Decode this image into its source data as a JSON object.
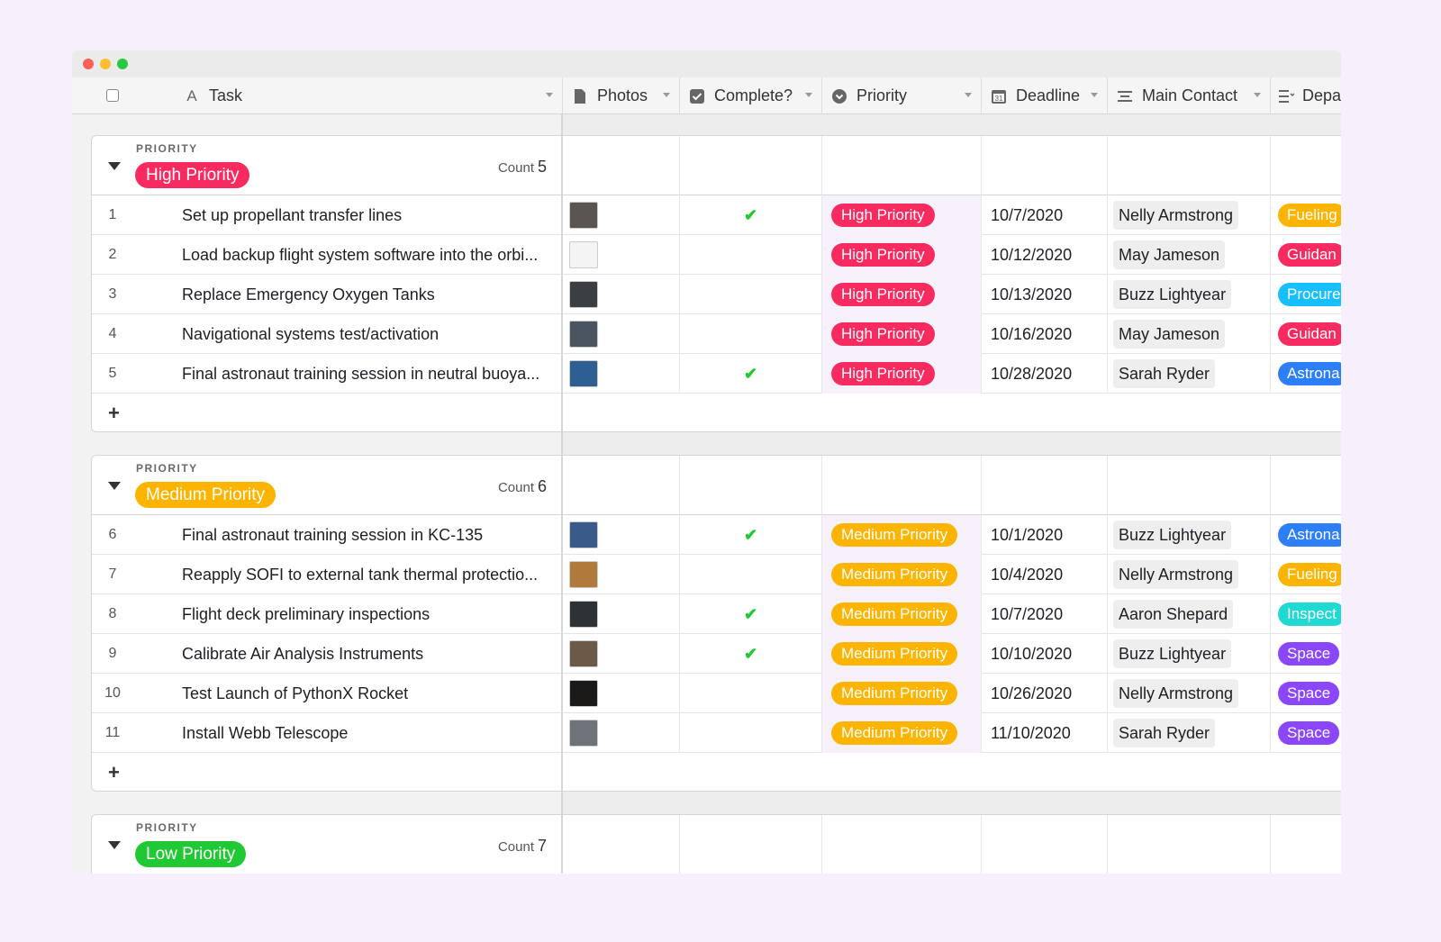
{
  "columns": {
    "task": "Task",
    "photos": "Photos",
    "complete": "Complete?",
    "priority": "Priority",
    "deadline": "Deadline",
    "contact": "Main Contact",
    "dept": "Depa"
  },
  "icons": {
    "task": "text-field-icon",
    "photos": "attachment-icon",
    "complete": "checkbox-icon",
    "priority": "single-select-icon",
    "deadline": "calendar-icon",
    "contact": "collaborator-icon",
    "dept": "multi-select-icon"
  },
  "colors": {
    "high": "#f82b60",
    "medium": "#fcb400",
    "low": "#20c933",
    "fueling": "#fcb400",
    "guidance": "#f82b60",
    "procurement": "#18bfff",
    "astronaut": "#2d7ff9",
    "inspection": "#20d9d2",
    "space": "#8b46ff"
  },
  "groups": [
    {
      "label": "PRIORITY",
      "name": "High Priority",
      "color": "#f82b60",
      "count_label": "Count",
      "count": "5",
      "rows": [
        {
          "num": "1",
          "task": "Set up propellant transfer lines",
          "complete": "✔",
          "priority": "High Priority",
          "deadline": "10/7/2020",
          "contact": "Nelly Armstrong",
          "dept": "Fueling",
          "dept_color": "#fcb400",
          "thumb": "#5a5550"
        },
        {
          "num": "2",
          "task": "Load backup flight system software into the orbi...",
          "complete": "",
          "priority": "High Priority",
          "deadline": "10/12/2020",
          "contact": "May Jameson",
          "dept": "Guidan",
          "dept_color": "#f82b60",
          "thumb": "#f4f4f4"
        },
        {
          "num": "3",
          "task": "Replace Emergency Oxygen Tanks",
          "complete": "",
          "priority": "High Priority",
          "deadline": "10/13/2020",
          "contact": "Buzz Lightyear",
          "dept": "Procure",
          "dept_color": "#18bfff",
          "thumb": "#3b3f44"
        },
        {
          "num": "4",
          "task": "Navigational systems test/activation",
          "complete": "",
          "priority": "High Priority",
          "deadline": "10/16/2020",
          "contact": "May Jameson",
          "dept": "Guidan",
          "dept_color": "#f82b60",
          "thumb": "#4a5560"
        },
        {
          "num": "5",
          "task": "Final astronaut training session in neutral buoya...",
          "complete": "✔",
          "priority": "High Priority",
          "deadline": "10/28/2020",
          "contact": "Sarah Ryder",
          "dept": "Astrona",
          "dept_color": "#2d7ff9",
          "thumb": "#2d5f93"
        }
      ]
    },
    {
      "label": "PRIORITY",
      "name": "Medium Priority",
      "color": "#fcb400",
      "count_label": "Count",
      "count": "6",
      "rows": [
        {
          "num": "6",
          "task": "Final astronaut training session in KC-135",
          "complete": "✔",
          "priority": "Medium Priority",
          "deadline": "10/1/2020",
          "contact": "Buzz Lightyear",
          "dept": "Astrona",
          "dept_color": "#2d7ff9",
          "thumb": "#3a5a8a"
        },
        {
          "num": "7",
          "task": "Reapply SOFI to external tank thermal protectio...",
          "complete": "",
          "priority": "Medium Priority",
          "deadline": "10/4/2020",
          "contact": "Nelly Armstrong",
          "dept": "Fueling",
          "dept_color": "#fcb400",
          "thumb": "#b07a3c"
        },
        {
          "num": "8",
          "task": "Flight deck preliminary inspections",
          "complete": "✔",
          "priority": "Medium Priority",
          "deadline": "10/7/2020",
          "contact": "Aaron Shepard",
          "dept": "Inspect",
          "dept_color": "#20d9d2",
          "thumb": "#2e3236"
        },
        {
          "num": "9",
          "task": "Calibrate Air Analysis Instruments",
          "complete": "✔",
          "priority": "Medium Priority",
          "deadline": "10/10/2020",
          "contact": "Buzz Lightyear",
          "dept": "Space",
          "dept_color": "#8b46ff",
          "thumb": "#6b5a48"
        },
        {
          "num": "10",
          "task": "Test Launch of PythonX Rocket",
          "complete": "",
          "priority": "Medium Priority",
          "deadline": "10/26/2020",
          "contact": "Nelly Armstrong",
          "dept": "Space",
          "dept_color": "#8b46ff",
          "thumb": "#1b1a18"
        },
        {
          "num": "11",
          "task": "Install Webb Telescope",
          "complete": "",
          "priority": "Medium Priority",
          "deadline": "11/10/2020",
          "contact": "Sarah Ryder",
          "dept": "Space",
          "dept_color": "#8b46ff",
          "thumb": "#6d7378"
        }
      ]
    },
    {
      "label": "PRIORITY",
      "name": "Low Priority",
      "color": "#20c933",
      "count_label": "Count",
      "count": "7",
      "rows": []
    }
  ]
}
